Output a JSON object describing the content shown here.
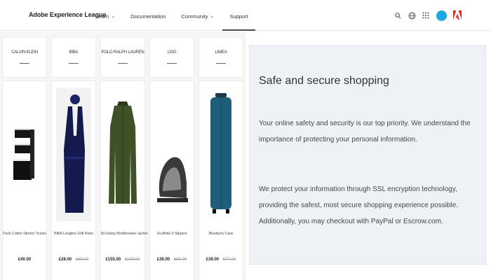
{
  "header": {
    "brand": "Adobe Experience League",
    "nav": [
      {
        "label": "Learn",
        "has_dropdown": true
      },
      {
        "label": "Documentation",
        "has_dropdown": false
      },
      {
        "label": "Community",
        "has_dropdown": true
      },
      {
        "label": "Support",
        "has_dropdown": false,
        "active": true
      }
    ],
    "icons": [
      "search-icon",
      "globe-icon",
      "apps-grid-icon",
      "avatar",
      "adobe-logo-icon"
    ],
    "colors": {
      "avatar": "#1fa7e0",
      "adobe_logo": "#e0251b"
    }
  },
  "products": [
    {
      "brand": "CALVIN KLEIN",
      "name": "Pack Cotton Stretch Trunks",
      "price": "£40.00",
      "was": ""
    },
    {
      "brand": "BIBA",
      "name": "BIBA Longline Soft Robe",
      "price": "£28.00",
      "was": "£69.00"
    },
    {
      "brand": "POLO RALPH LAUREN",
      "name": "Bi-Swing Windbreaker Jacket",
      "price": "£155.00",
      "was": "£198.00"
    },
    {
      "brand": "UGG",
      "name": "Scuffette II Slippers",
      "price": "£36.00",
      "was": "£68.00"
    },
    {
      "brand": "LIMEA",
      "name": "Blueberry Case",
      "price": "£39.00",
      "was": "£70.00"
    }
  ],
  "info": {
    "title": "Safe and secure shopping",
    "paragraph1": "Your online safety and security is our top priority. We understand the importance of protecting your personal information.",
    "paragraph2": "We protect your information through SSL encryption technology, providing the safest, most secure shopping experience possible. Additionally, you may checkout with PayPal or Escrow.com."
  }
}
